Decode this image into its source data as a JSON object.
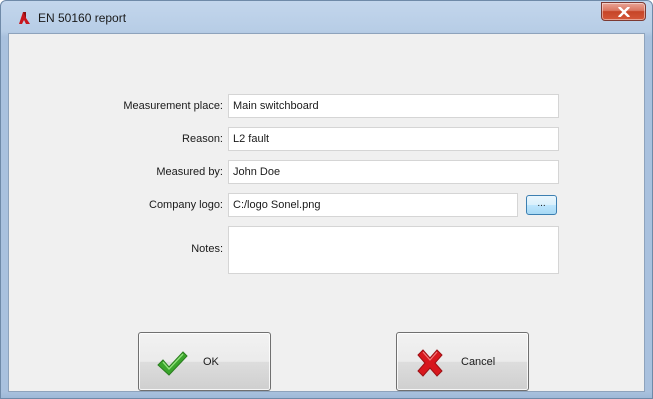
{
  "window": {
    "title": "EN 50160 report",
    "app_icon": "sonel-app-icon",
    "close_icon": "close-x-icon"
  },
  "form": {
    "measurement_place": {
      "label": "Measurement place:",
      "value": "Main switchboard"
    },
    "reason": {
      "label": "Reason:",
      "value": "L2 fault"
    },
    "measured_by": {
      "label": "Measured by:",
      "value": "John Doe"
    },
    "company_logo": {
      "label": "Company logo:",
      "value": "C:/logo Sonel.png",
      "browse_label": "..."
    },
    "notes": {
      "label": "Notes:",
      "value": ""
    }
  },
  "buttons": {
    "ok": {
      "label": "OK",
      "icon": "green-checkmark-icon"
    },
    "cancel": {
      "label": "Cancel",
      "icon": "red-x-icon"
    }
  },
  "colors": {
    "frame": "#b7cde6",
    "close_button": "#c64527",
    "ok_icon": "#3aa52c",
    "cancel_icon": "#d8171d",
    "browse_button_border": "#3c7fb1"
  }
}
